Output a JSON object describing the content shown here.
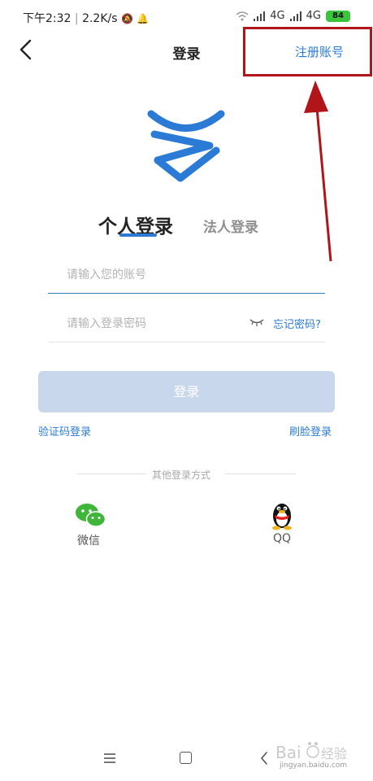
{
  "status_bar": {
    "time": "下午2:32",
    "speed": "2.2K/s",
    "network_1": "4G",
    "network_2": "4G",
    "battery": "84"
  },
  "header": {
    "title": "登录",
    "register_label": "注册账号",
    "annotation_color": "#b1151a"
  },
  "tabs": {
    "personal": "个人登录",
    "legal": "法人登录"
  },
  "form": {
    "account_placeholder": "请输入您的账号",
    "password_placeholder": "请输入登录密码",
    "forgot_label": "忘记密码?",
    "login_label": "登录"
  },
  "links": {
    "sms_login": "验证码登录",
    "face_login": "刷脸登录"
  },
  "other_methods": {
    "label": "其他登录方式",
    "wechat": "微信",
    "qq": "QQ"
  },
  "watermark": {
    "text": "jingyan.baidu.com"
  },
  "colors": {
    "accent": "#2b7bd6",
    "login_button_disabled": "#c9d7ec"
  }
}
